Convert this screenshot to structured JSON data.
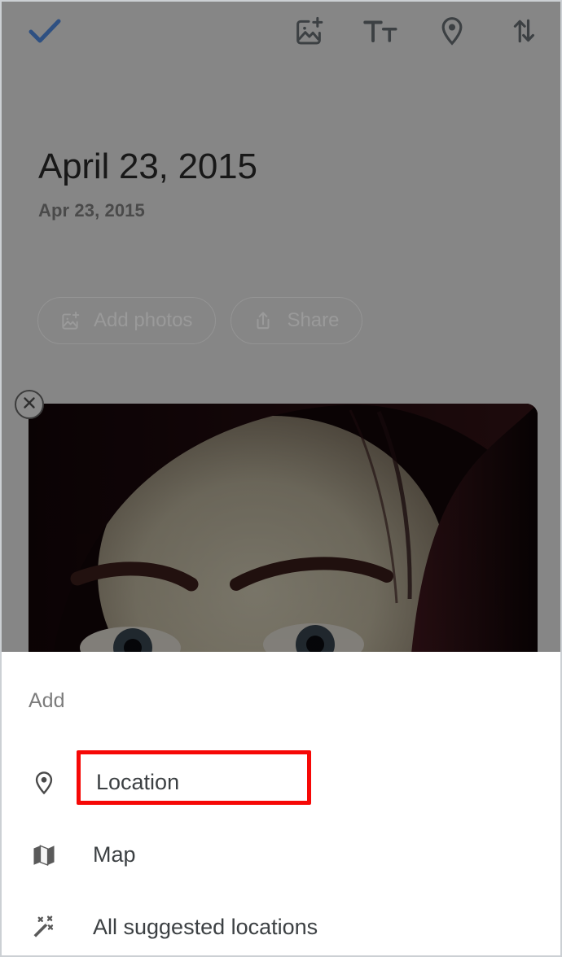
{
  "app": {
    "screen_name": "memory-editor",
    "scrim_color": "#868686"
  },
  "appbar": {
    "confirm": {
      "icon": "check-icon",
      "label": "Done",
      "color": "#2b4c7e"
    },
    "actions": [
      {
        "icon": "add-photo-icon",
        "label": "Add photos"
      },
      {
        "icon": "text-format-icon",
        "label": "Text"
      },
      {
        "icon": "location-pin-icon",
        "label": "Location"
      },
      {
        "icon": "sort-icon",
        "label": "Sort"
      }
    ]
  },
  "memory": {
    "title": "April 23, 2015",
    "subtitle": "Apr 23, 2015"
  },
  "chips": [
    {
      "icon": "add-photo-icon",
      "label": "Add photos"
    },
    {
      "icon": "share-icon",
      "label": "Share"
    }
  ],
  "photo": {
    "remove_icon": "close-circle-icon",
    "alt": "Close-up photo of a person's forehead and eyes"
  },
  "sheet": {
    "title": "Add",
    "items": [
      {
        "icon": "location-pin-icon",
        "label": "Location",
        "highlighted": true
      },
      {
        "icon": "map-icon",
        "label": "Map",
        "highlighted": false
      },
      {
        "icon": "magic-wand-icon",
        "label": "All suggested locations",
        "highlighted": false
      }
    ]
  },
  "annotation": {
    "type": "highlight-rectangle",
    "color": "#f60806",
    "target": "Location"
  }
}
